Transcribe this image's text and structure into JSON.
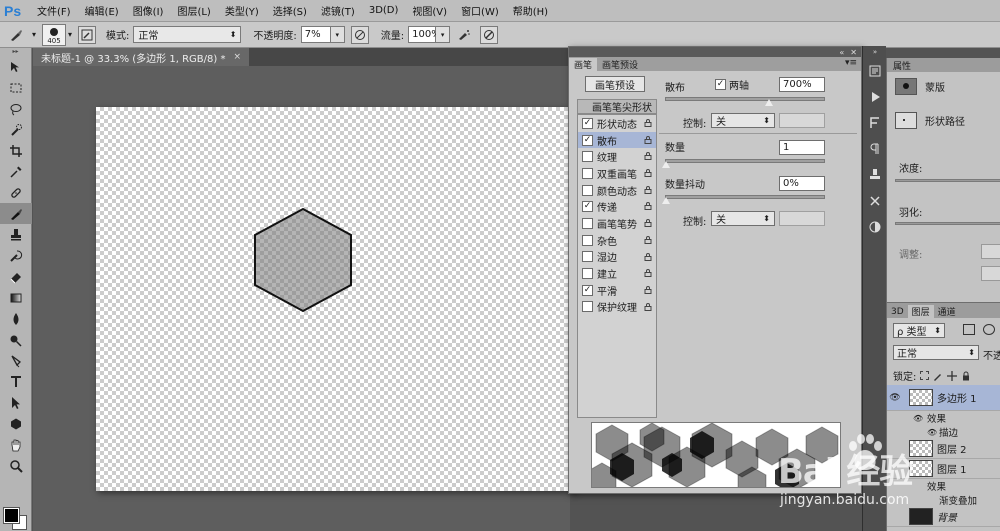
{
  "app": {
    "logo": "Ps"
  },
  "menu": [
    "文件(F)",
    "编辑(E)",
    "图像(I)",
    "图层(L)",
    "类型(Y)",
    "选择(S)",
    "滤镜(T)",
    "3D(D)",
    "视图(V)",
    "窗口(W)",
    "帮助(H)"
  ],
  "options": {
    "brush_size": "405",
    "mode_label": "模式:",
    "mode_value": "正常",
    "opacity_label": "不透明度:",
    "opacity_value": "7%",
    "flow_label": "流量:",
    "flow_value": "100%"
  },
  "document": {
    "tab_title": "未标题-1 @ 33.3% (多边形 1, RGB/8) *",
    "close": "×"
  },
  "brush_panel": {
    "tabs": [
      "画笔",
      "画笔预设"
    ],
    "preset_button": "画笔预设",
    "tip_shape": "画笔笔尖形状",
    "items": [
      {
        "label": "形状动态",
        "checked": true
      },
      {
        "label": "散布",
        "checked": true,
        "active": true
      },
      {
        "label": "纹理",
        "checked": false
      },
      {
        "label": "双重画笔",
        "checked": false
      },
      {
        "label": "颜色动态",
        "checked": false
      },
      {
        "label": "传递",
        "checked": true
      },
      {
        "label": "画笔笔势",
        "checked": false
      },
      {
        "label": "杂色",
        "checked": false
      },
      {
        "label": "湿边",
        "checked": false
      },
      {
        "label": "建立",
        "checked": false
      },
      {
        "label": "平滑",
        "checked": true
      },
      {
        "label": "保护纹理",
        "checked": false
      }
    ],
    "settings": {
      "scatter_label": "散布",
      "both_axes_label": "两轴",
      "scatter_value": "700%",
      "scatter_fraction": 0.65,
      "control_label": "控制:",
      "control_value": "关",
      "count_label": "数量",
      "count_value": "1",
      "count_jitter_label": "数量抖动",
      "count_jitter_value": "0%",
      "control2_label": "控制:",
      "control2_value": "关"
    }
  },
  "properties": {
    "title": "属性",
    "mask_label": "蒙版",
    "path_label": "形状路径",
    "density_label": "浓度:",
    "feather_label": "羽化:",
    "adjust_label": "调整:"
  },
  "layers": {
    "tabs": [
      "3D",
      "图层",
      "通道"
    ],
    "filter_value": "ρ 类型",
    "mode_value": "正常",
    "opacity_label": "不透",
    "lock_label": "锁定:",
    "rows": [
      {
        "name": "多边形 1",
        "type": "shape",
        "selected": true
      },
      {
        "name": "效果",
        "type": "sub"
      },
      {
        "name": "描边",
        "type": "sub"
      },
      {
        "name": "图层 2",
        "type": "layer"
      },
      {
        "name": "图层 1",
        "type": "layer"
      },
      {
        "name": "效果",
        "type": "sub"
      },
      {
        "name": "渐变叠加",
        "type": "sub"
      },
      {
        "name": "背景",
        "type": "bg"
      }
    ]
  },
  "watermark": {
    "brand": "Bai 经验",
    "url": "jingyan.baidu.com"
  }
}
